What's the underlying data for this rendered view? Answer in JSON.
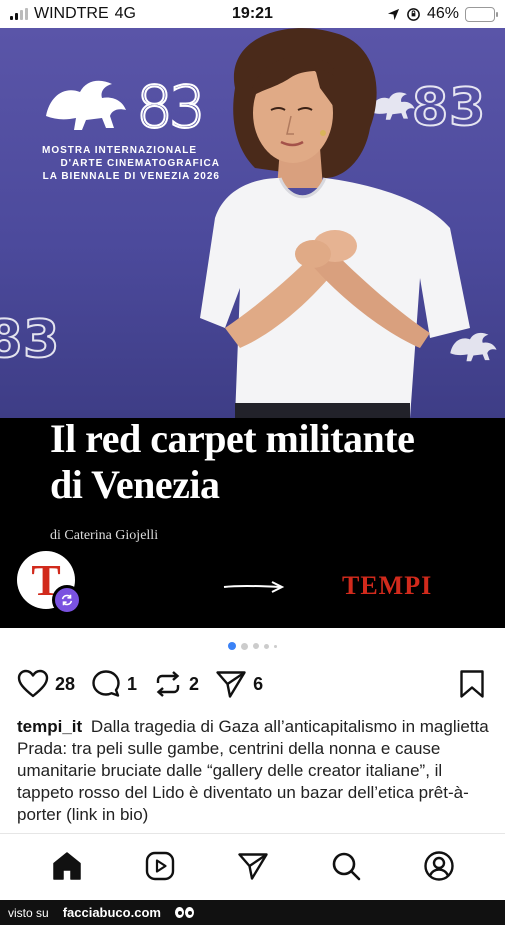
{
  "status_bar": {
    "carrier": "WINDTRE",
    "network": "4G",
    "time": "19:21",
    "battery": "46%",
    "battery_level": 0.46
  },
  "post_image": {
    "logo": {
      "number": "83",
      "lines": [
        "MOSTRA INTERNAZIONALE",
        "D'ARTE CINEMATOGRAFICA",
        "LA BIENNALE DI VENEZIA 2026"
      ]
    },
    "headline_line1": "Il red carpet militante",
    "headline_line2": "di Venezia",
    "byline": "di Caterina Giojelli",
    "avatar_letter": "T",
    "brand": "TEMPI"
  },
  "carousel": {
    "current": 1,
    "total": 5
  },
  "actions": {
    "likes": "28",
    "comments": "1",
    "reposts": "2",
    "shares": "6"
  },
  "caption": {
    "username": "tempi_it",
    "text": "Dalla tragedia di Gaza all’anticapitalismo in maglietta Prada: tra peli sulle gambe, centrini della nonna e cause umanitarie bruciate dalle “gallery delle creator italiane”, il tappeto rosso del Lido è diventato un bazar dell’etica prêt-à-porter (link in bio)"
  },
  "nav": [
    "home-icon",
    "reels-icon",
    "send-icon",
    "search-icon",
    "profile-icon"
  ],
  "footer": {
    "prefix": "visto su",
    "site": "facciabuco.com"
  },
  "colors": {
    "accent": "#3b82f6",
    "brand_red": "#d12a1c",
    "repost_badge": "#7a52e0",
    "backdrop": "#4c4a9c"
  }
}
